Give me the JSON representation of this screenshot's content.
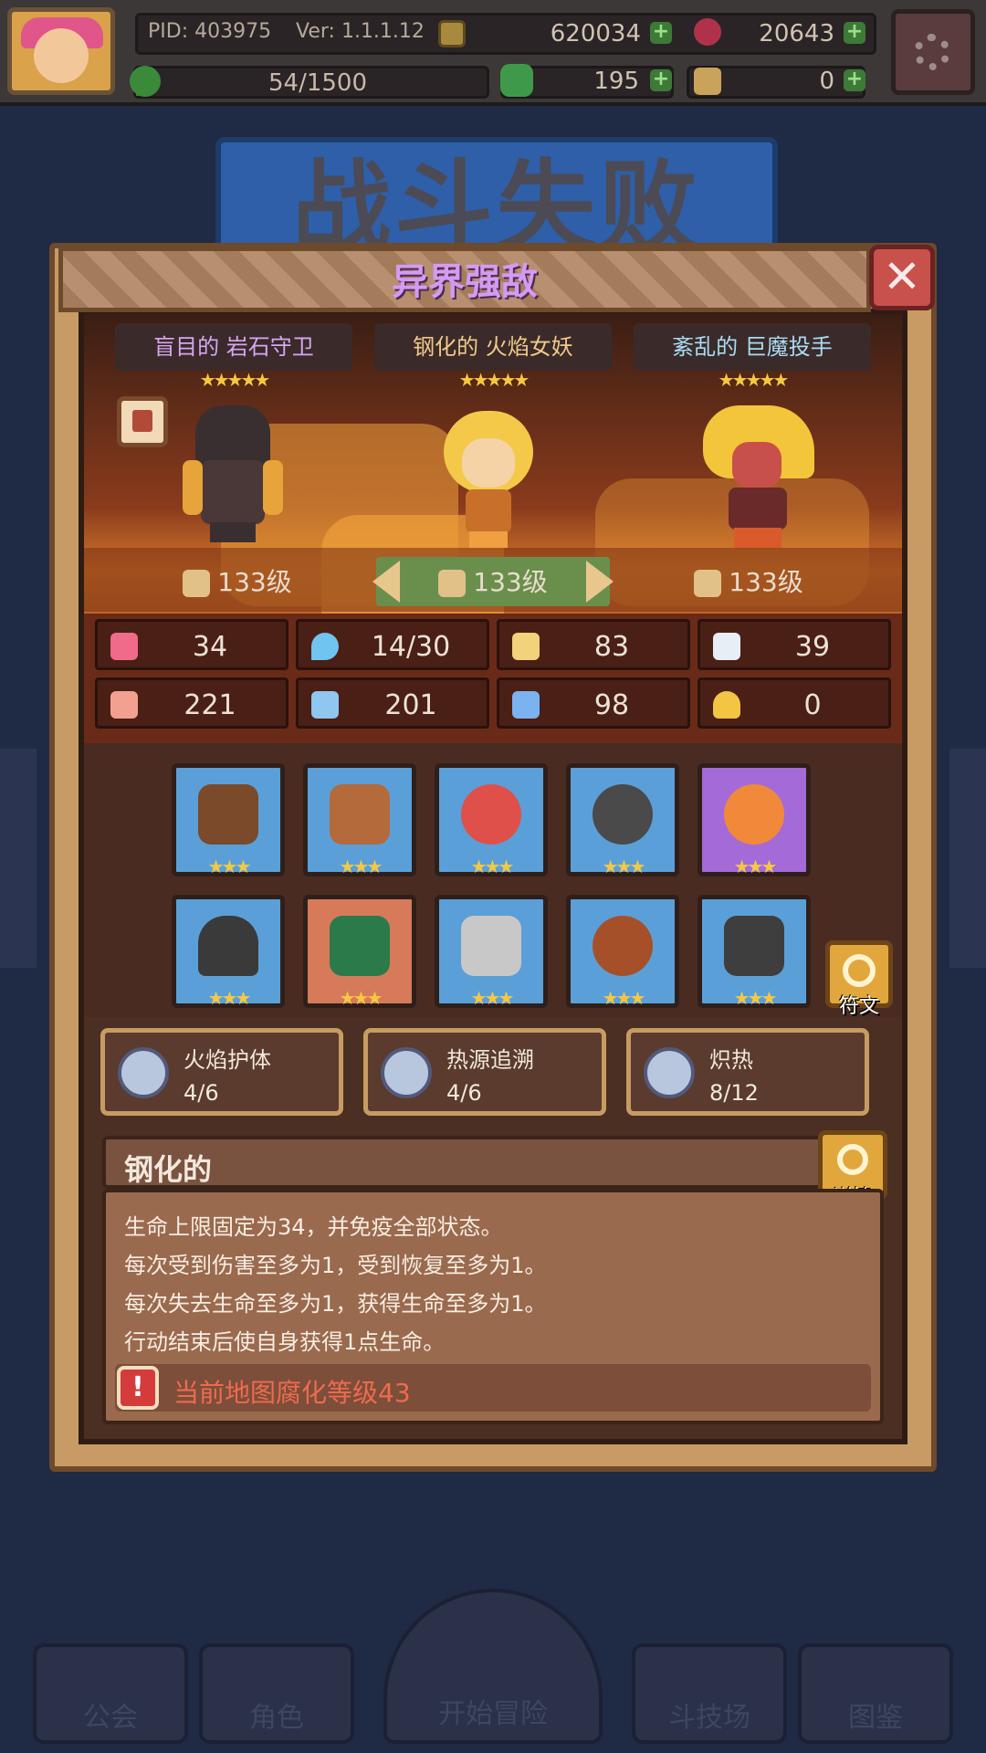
{
  "topbar": {
    "pid": "PID: 403975",
    "version": "Ver: 1.1.1.12",
    "gold": "620034",
    "gems": "20643",
    "energy": "54/1500",
    "clover": "195",
    "tickets": "0",
    "icons": {
      "gold": "coin-icon",
      "gems": "gem-icon",
      "clover": "clover-icon",
      "tickets": "ticket-icon",
      "settings": "gear-icon"
    }
  },
  "background": {
    "title": "战斗失败",
    "nav": [
      "公会",
      "角色",
      "开始冒险",
      "斗技场",
      "图鉴"
    ]
  },
  "modal": {
    "title": "异界强敌",
    "enemies": [
      {
        "name": "盲目的 岩石守卫",
        "stars": "★★★★★",
        "level": "133级",
        "level_icon": "sword-icon",
        "name_color": "#d6a7f2"
      },
      {
        "name": "钢化的 火焰女妖",
        "stars": "★★★★★",
        "level": "133级",
        "level_icon": "sword-icon",
        "name_color": "#f0c98a"
      },
      {
        "name": "紊乱的 巨魔投手",
        "stars": "★★★★★",
        "level": "133级",
        "level_icon": "scroll-icon",
        "name_color": "#a9dcf2"
      }
    ],
    "stats": [
      {
        "icon": "heart-icon",
        "value": "34",
        "color": "#f06a8a"
      },
      {
        "icon": "water-drop-icon",
        "value": "14/30",
        "color": "#6fc4f0"
      },
      {
        "icon": "shield-icon",
        "value": "83",
        "color": "#f2d27a"
      },
      {
        "icon": "wing-icon",
        "value": "39",
        "color": "#e8eef5"
      },
      {
        "icon": "fist-icon",
        "value": "221",
        "color": "#f2a090"
      },
      {
        "icon": "book-icon",
        "value": "201",
        "color": "#8fc7f0"
      },
      {
        "icon": "card-icon",
        "value": "98",
        "color": "#7ab3f0"
      },
      {
        "icon": "horseshoe-icon",
        "value": "0",
        "color": "#f2c542"
      }
    ],
    "equipment": [
      {
        "name": "hammer-icon",
        "stars": "★★★",
        "frame": "#5b9fd8",
        "glyph": "#7a4a2a"
      },
      {
        "name": "shield-icon",
        "stars": "★★★",
        "frame": "#5b9fd8",
        "glyph": "#b46a3a"
      },
      {
        "name": "necklace-icon",
        "stars": "★★★",
        "frame": "#5b9fd8",
        "glyph": "#e0504a"
      },
      {
        "name": "round-shield-icon",
        "stars": "★★★",
        "frame": "#5b9fd8",
        "glyph": "#4a4a4a"
      },
      {
        "name": "ring-icon",
        "stars": "★★★",
        "frame": "#a36ad8",
        "glyph": "#f08a3a"
      },
      {
        "name": "helmet-icon",
        "stars": "★★★",
        "frame": "#5b9fd8",
        "glyph": "#3a3a3a"
      },
      {
        "name": "armor-icon",
        "stars": "★★★",
        "frame": "#d77a5a",
        "glyph": "#2a7a4a"
      },
      {
        "name": "gauntlet-icon",
        "stars": "★★★",
        "frame": "#5b9fd8",
        "glyph": "#c8c8c8"
      },
      {
        "name": "belt-icon",
        "stars": "★★★",
        "frame": "#5b9fd8",
        "glyph": "#a6502a"
      },
      {
        "name": "boots-icon",
        "stars": "★★★",
        "frame": "#5b9fd8",
        "glyph": "#3e3e3e"
      }
    ],
    "rune_label": "符文",
    "synergies": [
      {
        "name": "火焰护体",
        "count": "4/6"
      },
      {
        "name": "热源追溯",
        "count": "4/6"
      },
      {
        "name": "炽热",
        "count": "8/12"
      }
    ],
    "trait": {
      "name": "钢化的",
      "detail_label": "详情",
      "lines": [
        "生命上限固定为34，并免疫全部状态。",
        "每次受到伤害至多为1，受到恢复至多为1。",
        "每次失去生命至多为1，获得生命至多为1。",
        "行动结束后使自身获得1点生命。"
      ],
      "warning": "当前地图腐化等级43"
    }
  }
}
